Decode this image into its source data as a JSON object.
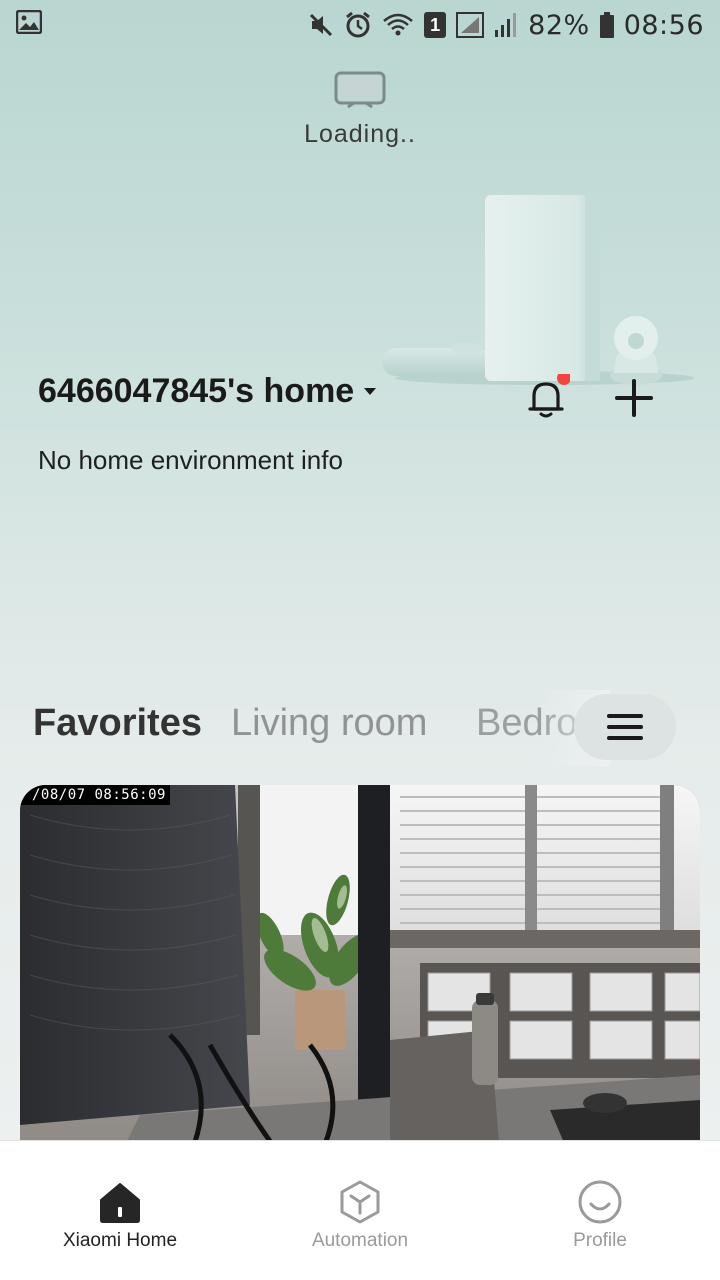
{
  "status_bar": {
    "battery": "82%",
    "time": "08:56",
    "sim_slot": "1"
  },
  "header": {
    "device_status": "Loading..",
    "home_name": "6466047845's home",
    "env_info": "No home environment info"
  },
  "tabs": {
    "items": [
      "Favorites",
      "Living room",
      "Bedroom"
    ],
    "active_index": 0
  },
  "camera": {
    "timestamp": "/08/07  08:56:09"
  },
  "bottom_nav": {
    "items": [
      {
        "label": "Xiaomi Home",
        "icon": "home-icon",
        "active": true
      },
      {
        "label": "Automation",
        "icon": "automation-cube-icon",
        "active": false
      },
      {
        "label": "Profile",
        "icon": "profile-smile-icon",
        "active": false
      }
    ]
  },
  "colors": {
    "accent_dot": "#f2453d",
    "active_text": "#222222",
    "inactive_text": "#9a9a9a"
  }
}
